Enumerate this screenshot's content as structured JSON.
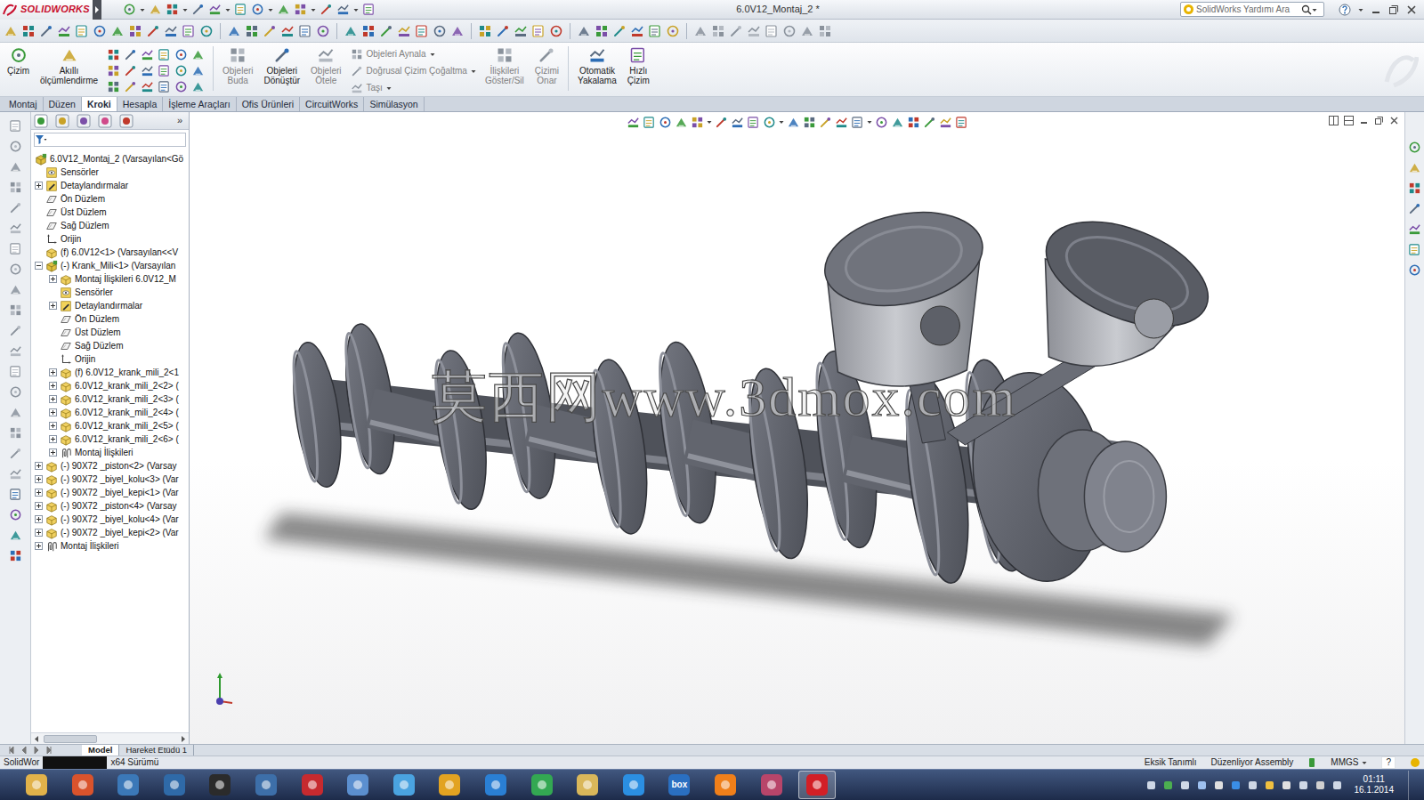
{
  "window": {
    "logo": "SOLIDWORKS",
    "title": "6.0V12_Montaj_2 *"
  },
  "search": {
    "placeholder": "SolidWorks Yardımı Ara"
  },
  "commands": [
    {
      "label": "Çizim",
      "kind": "large",
      "disabled": false
    },
    {
      "label": "Akıllı ölçümlendirme",
      "kind": "large",
      "disabled": false
    },
    {
      "label": "Objeleri Buda",
      "kind": "large",
      "disabled": true
    },
    {
      "label": "Objeleri Dönüştür",
      "kind": "large",
      "disabled": false
    },
    {
      "label": "Objeleri Ötele",
      "kind": "large",
      "disabled": true
    },
    {
      "label": "Objeleri Aynala",
      "kind": "small",
      "disabled": true
    },
    {
      "label": "Doğrusal Çizim Çoğaltma",
      "kind": "small",
      "disabled": true
    },
    {
      "label": "Taşı",
      "kind": "small",
      "disabled": true
    },
    {
      "label": "İlişkileri Göster/Sil",
      "kind": "large",
      "disabled": true
    },
    {
      "label": "Çizimi Onar",
      "kind": "large",
      "disabled": true
    },
    {
      "label": "Otomatik Yakalama",
      "kind": "large",
      "disabled": false
    },
    {
      "label": "Hızlı Çizim",
      "kind": "large",
      "disabled": false
    }
  ],
  "tabs": [
    {
      "label": "Montaj",
      "selected": false
    },
    {
      "label": "Düzen",
      "selected": false
    },
    {
      "label": "Kroki",
      "selected": true
    },
    {
      "label": "Hesapla",
      "selected": false
    },
    {
      "label": "İşleme Araçları",
      "selected": false
    },
    {
      "label": "Ofis Ürünleri",
      "selected": false
    },
    {
      "label": "CircuitWorks",
      "selected": false
    },
    {
      "label": "Simülasyon",
      "selected": false
    }
  ],
  "panel": {
    "more": "»"
  },
  "tree": {
    "items": [
      {
        "label": "6.0V12_Montaj_2  (Varsayılan<Gö",
        "level": 0,
        "kind": "assembly",
        "expandable": false,
        "expanded": false
      },
      {
        "label": "Sensörler",
        "level": 1,
        "kind": "sensor",
        "expandable": false,
        "expanded": false
      },
      {
        "label": "Detaylandırmalar",
        "level": 1,
        "kind": "annotation",
        "expandable": true,
        "expanded": false
      },
      {
        "label": "Ön Düzlem",
        "level": 1,
        "kind": "plane",
        "expandable": false,
        "expanded": false
      },
      {
        "label": "Üst Düzlem",
        "level": 1,
        "kind": "plane",
        "expandable": false,
        "expanded": false
      },
      {
        "label": "Sağ Düzlem",
        "level": 1,
        "kind": "plane",
        "expandable": false,
        "expanded": false
      },
      {
        "label": "Orijin",
        "level": 1,
        "kind": "origin",
        "expandable": false,
        "expanded": false
      },
      {
        "label": "(f) 6.0V12<1> (Varsayılan<<V",
        "level": 1,
        "kind": "part",
        "expandable": false,
        "expanded": false
      },
      {
        "label": "(-) Krank_Mili<1> (Varsayılan",
        "level": 1,
        "kind": "assembly",
        "expandable": true,
        "expanded": true
      },
      {
        "label": "Montaj İlişkileri 6.0V12_M",
        "level": 2,
        "kind": "part",
        "expandable": true,
        "expanded": false
      },
      {
        "label": "Sensörler",
        "level": 2,
        "kind": "sensor",
        "expandable": false,
        "expanded": false
      },
      {
        "label": "Detaylandırmalar",
        "level": 2,
        "kind": "annotation",
        "expandable": true,
        "expanded": false
      },
      {
        "label": "Ön Düzlem",
        "level": 2,
        "kind": "plane",
        "expandable": false,
        "expanded": false
      },
      {
        "label": "Üst Düzlem",
        "level": 2,
        "kind": "plane",
        "expandable": false,
        "expanded": false
      },
      {
        "label": "Sağ Düzlem",
        "level": 2,
        "kind": "plane",
        "expandable": false,
        "expanded": false
      },
      {
        "label": "Orijin",
        "level": 2,
        "kind": "origin",
        "expandable": false,
        "expanded": false
      },
      {
        "label": "(f) 6.0V12_krank_mili_2<1",
        "level": 2,
        "kind": "part",
        "expandable": true,
        "expanded": false
      },
      {
        "label": "6.0V12_krank_mili_2<2> (",
        "level": 2,
        "kind": "part",
        "expandable": true,
        "expanded": false
      },
      {
        "label": "6.0V12_krank_mili_2<3> (",
        "level": 2,
        "kind": "part",
        "expandable": true,
        "expanded": false
      },
      {
        "label": "6.0V12_krank_mili_2<4> (",
        "level": 2,
        "kind": "part",
        "expandable": true,
        "expanded": false
      },
      {
        "label": "6.0V12_krank_mili_2<5> (",
        "level": 2,
        "kind": "part",
        "expandable": true,
        "expanded": false
      },
      {
        "label": "6.0V12_krank_mili_2<6> (",
        "level": 2,
        "kind": "part",
        "expandable": true,
        "expanded": false
      },
      {
        "label": "Montaj İlişkileri",
        "level": 2,
        "kind": "mates",
        "expandable": true,
        "expanded": false
      },
      {
        "label": "(-) 90X72 _piston<2> (Varsay",
        "level": 1,
        "kind": "part",
        "expandable": true,
        "expanded": false
      },
      {
        "label": "(-) 90X72 _biyel_kolu<3> (Var",
        "level": 1,
        "kind": "part",
        "expandable": true,
        "expanded": false
      },
      {
        "label": "(-) 90X72 _biyel_kepi<1> (Var",
        "level": 1,
        "kind": "part",
        "expandable": true,
        "expanded": false
      },
      {
        "label": "(-) 90X72 _piston<4> (Varsay",
        "level": 1,
        "kind": "part",
        "expandable": true,
        "expanded": false
      },
      {
        "label": "(-) 90X72 _biyel_kolu<4> (Var",
        "level": 1,
        "kind": "part",
        "expandable": true,
        "expanded": false
      },
      {
        "label": "(-) 90X72 _biyel_kepi<2> (Var",
        "level": 1,
        "kind": "part",
        "expandable": true,
        "expanded": false
      },
      {
        "label": "Montaj İlişkileri",
        "level": 1,
        "kind": "mates",
        "expandable": true,
        "expanded": false
      }
    ]
  },
  "watermark": "莫西网www.3dmox.com",
  "model_tabs": [
    {
      "label": "Model",
      "selected": true
    },
    {
      "label": "Hareket Etüdü 1",
      "selected": false
    }
  ],
  "status_bar": {
    "left": "SolidWor",
    "version": "x64 Sürümü",
    "state": "Eksik Tanımlı",
    "mode": "Düzenliyor Assembly",
    "units": "MMGS",
    "help": "?"
  },
  "taskbar": {
    "apps": [
      {
        "color": "#e1b24a",
        "selected": false
      },
      {
        "color": "#d9532c",
        "selected": false
      },
      {
        "color": "#3b78b8",
        "selected": false
      },
      {
        "color": "#2f6aa8",
        "selected": false
      },
      {
        "color": "#2b2b2b",
        "selected": false
      },
      {
        "color": "#3d6fa9",
        "selected": false
      },
      {
        "color": "#c62a2f",
        "selected": false
      },
      {
        "color": "#5b8fcf",
        "selected": false
      },
      {
        "color": "#4aa3e0",
        "selected": false
      },
      {
        "color": "#e2a321",
        "selected": false
      },
      {
        "color": "#2a7fd4",
        "selected": false
      },
      {
        "color": "#33a852",
        "selected": false
      },
      {
        "color": "#d9b75a",
        "selected": false
      },
      {
        "color": "#2b8fe2",
        "selected": false
      },
      {
        "color": "#2a6fc1",
        "selected": false,
        "label": "box"
      },
      {
        "color": "#ef7f1a",
        "selected": false
      },
      {
        "color": "#b8456a",
        "selected": false
      },
      {
        "color": "#d21f26",
        "selected": true
      }
    ],
    "time": "01:11",
    "date": "16.1.2014"
  }
}
